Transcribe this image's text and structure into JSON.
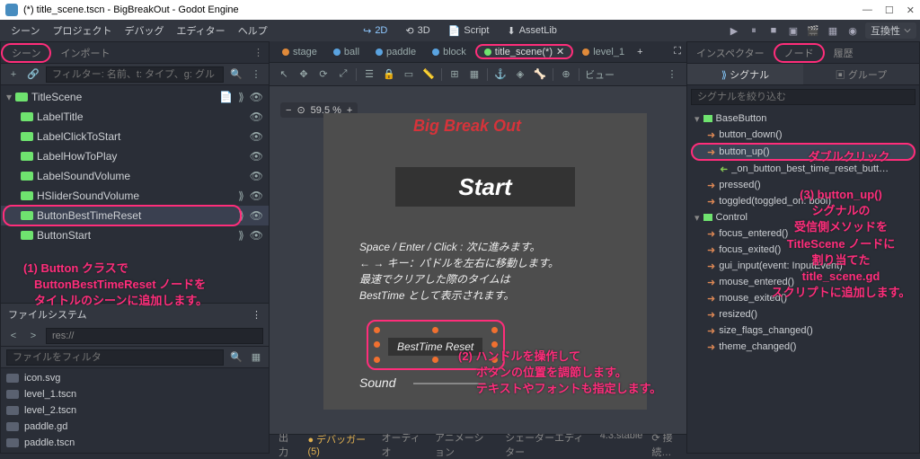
{
  "titlebar": {
    "text": "(*) title_scene.tscn - BigBreakOut - Godot Engine",
    "min": "—",
    "max": "☐",
    "close": "✕"
  },
  "menubar": {
    "items": [
      "シーン",
      "プロジェクト",
      "デバッグ",
      "エディター",
      "ヘルプ"
    ],
    "modes": {
      "m2d": "2D",
      "m3d": "3D",
      "script": "Script",
      "assetlib": "AssetLib"
    },
    "compat": "互換性"
  },
  "left": {
    "tabs": {
      "scene": "シーン",
      "import": "インポート"
    },
    "filter_placeholder": "フィルター: 名前、t: タイプ、g: グル",
    "nodes": [
      {
        "name": "TitleScene"
      },
      {
        "name": "LabelTitle"
      },
      {
        "name": "LabelClickToStart"
      },
      {
        "name": "LabelHowToPlay"
      },
      {
        "name": "LabelSoundVolume"
      },
      {
        "name": "HSliderSoundVolume"
      },
      {
        "name": "ButtonBestTimeReset"
      },
      {
        "name": "ButtonStart"
      }
    ],
    "fs_header": "ファイルシステム",
    "fs_path": "res://",
    "fs_filter": "ファイルをフィルタ",
    "fs_items": [
      "icon.svg",
      "level_1.tscn",
      "level_2.tscn",
      "paddle.gd",
      "paddle.tscn"
    ]
  },
  "center": {
    "scene_tabs": [
      {
        "label": "stage",
        "dot": "d-orange"
      },
      {
        "label": "ball",
        "dot": "d-blue"
      },
      {
        "label": "paddle",
        "dot": "d-blue"
      },
      {
        "label": "block",
        "dot": "d-blue"
      },
      {
        "label": "title_scene(*)",
        "dot": "d-green",
        "active": true,
        "hl": true,
        "closable": true
      },
      {
        "label": "level_1",
        "dot": "d-orange"
      }
    ],
    "view_label": "ビュー",
    "zoom": "59.5 %",
    "game_title": "Big Break Out",
    "start_label": "Start",
    "instructions": [
      "Space / Enter / Click : 次に進みます。",
      "← → キー：パドルを左右に移動します。",
      "最速でクリアした際のタイムは",
      "BestTime として表示されます。"
    ],
    "best_time_btn": "BestTime Reset",
    "sound_label": "Sound",
    "bottom": {
      "output": "出力",
      "debugger": "デバッガー (5)",
      "audio": "オーディオ",
      "anim": "アニメーション",
      "shader": "シェーダーエディター",
      "version": "4.3.stable",
      "sync": "接続…"
    }
  },
  "right": {
    "tabs": {
      "inspector": "インスペクター",
      "node": "ノード",
      "history": "履歴"
    },
    "subtabs": {
      "signal": "シグナル",
      "group": "グループ"
    },
    "filter_placeholder": "シグナルを絞り込む",
    "signals": {
      "class1": "BaseButton",
      "items1": [
        {
          "t": "button_down()",
          "out": true
        },
        {
          "t": "button_up()",
          "out": true,
          "hl": true,
          "sel": true
        },
        {
          "t": "_on_button_best_time_reset_butt…",
          "in": true
        },
        {
          "t": "pressed()",
          "out": true
        },
        {
          "t": "toggled(toggled_on: bool)",
          "out": true
        }
      ],
      "class2": "Control",
      "items2": [
        "focus_entered()",
        "focus_exited()",
        "gui_input(event: InputEvent)",
        "mouse_entered()",
        "mouse_exited()",
        "resized()",
        "size_flags_changed()",
        "theme_changed()"
      ]
    }
  },
  "annotations": {
    "a1_l1": "(1) Button クラスで",
    "a1_l2": "ButtonBestTimeReset ノードを",
    "a1_l3": "タイトルのシーンに追加します。",
    "a2_l1": "(2) ハンドルを操作して",
    "a2_l2": "ボタンの位置を調節します。",
    "a2_l3": "テキストやフォントも指定します。",
    "a3": "ダブルクリック",
    "a4_l1": "(3) button_up()",
    "a4_l2": "シグナルの",
    "a4_l3": "受信側メソッドを",
    "a4_l4": "TitleScene ノードに",
    "a4_l5": "割り当てた",
    "a4_l6": "title_scene.gd",
    "a4_l7": "スクリプトに追加します。"
  }
}
